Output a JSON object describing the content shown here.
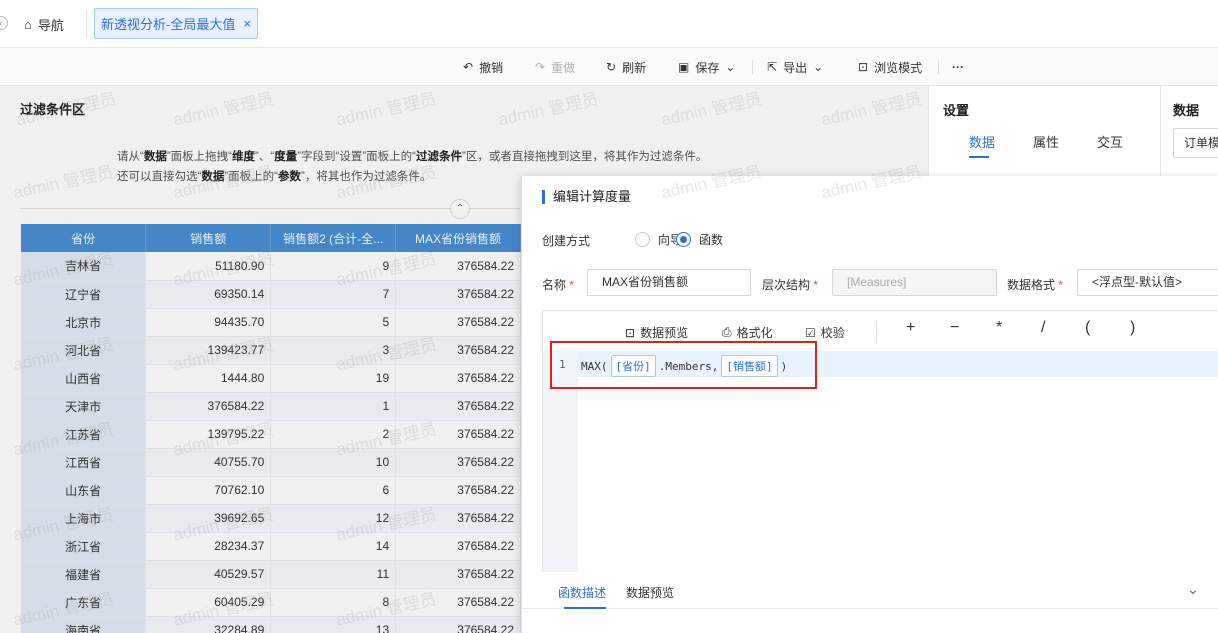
{
  "tabbar": {
    "home_label": "导航",
    "active_tab": "新透视分析-全局最大值",
    "close_glyph": "×"
  },
  "toolbar": {
    "undo": "撤销",
    "redo": "重做",
    "refresh": "刷新",
    "save": "保存",
    "export": "导出",
    "browse": "浏览模式",
    "more": "···"
  },
  "filter": {
    "title": "过滤条件区",
    "hint_line1_parts": [
      "请从“",
      "数据",
      "”面板上拖拽“",
      "维度",
      "”、“",
      "度量",
      "”字段到“设置”面板上的“",
      "过滤条件",
      "”区，或者直接拖拽到这里，将其作为过滤条件。"
    ],
    "hint_line2_parts": [
      "还可以直接勾选“",
      "数据",
      "”面板上的“",
      "参数",
      "”，将其也作为过滤条件。"
    ]
  },
  "table": {
    "headers": [
      "省份",
      "销售额",
      "销售额2 (合计-全...",
      "MAX省份销售额"
    ],
    "rows": [
      [
        "吉林省",
        "51180.90",
        "9",
        "376584.22"
      ],
      [
        "辽宁省",
        "69350.14",
        "7",
        "376584.22"
      ],
      [
        "北京市",
        "94435.70",
        "5",
        "376584.22"
      ],
      [
        "河北省",
        "139423.77",
        "3",
        "376584.22"
      ],
      [
        "山西省",
        "1444.80",
        "19",
        "376584.22"
      ],
      [
        "天津市",
        "376584.22",
        "1",
        "376584.22"
      ],
      [
        "江苏省",
        "139795.22",
        "2",
        "376584.22"
      ],
      [
        "江西省",
        "40755.70",
        "10",
        "376584.22"
      ],
      [
        "山东省",
        "70762.10",
        "6",
        "376584.22"
      ],
      [
        "上海市",
        "39692.65",
        "12",
        "376584.22"
      ],
      [
        "浙江省",
        "28234.37",
        "14",
        "376584.22"
      ],
      [
        "福建省",
        "40529.57",
        "11",
        "376584.22"
      ],
      [
        "广东省",
        "60405.29",
        "8",
        "376584.22"
      ],
      [
        "海南省",
        "32284.89",
        "13",
        "376584.22"
      ]
    ]
  },
  "settings": {
    "title": "设置",
    "tabs": [
      "数据",
      "属性",
      "交互"
    ]
  },
  "datapanel": {
    "title": "数据",
    "select_value": "订单模"
  },
  "dialog": {
    "title": "编辑计算度量",
    "create_mode_label": "创建方式",
    "mode_wizard": "向导",
    "mode_function": "函数",
    "name_label": "名称",
    "name_value": "MAX省份销售额",
    "hierarchy_label": "层次结构",
    "hierarchy_value": "[Measures]",
    "format_label": "数据格式",
    "format_value": "<浮点型-默认值>",
    "required_mark": "*",
    "editor_toolbar": {
      "preview": "数据预览",
      "format": "格式化",
      "validate": "校验"
    },
    "operators": [
      "+",
      "−",
      "*",
      "/",
      "(",
      ")"
    ],
    "code": {
      "line_no": "1",
      "fn": "MAX(",
      "token1": "[省份]",
      "member": ".Members,",
      "token2": "[销售额]",
      "close": ")"
    },
    "bottom_tabs": [
      "函数描述",
      "数据预览"
    ]
  },
  "watermark": "admin 管理员"
}
